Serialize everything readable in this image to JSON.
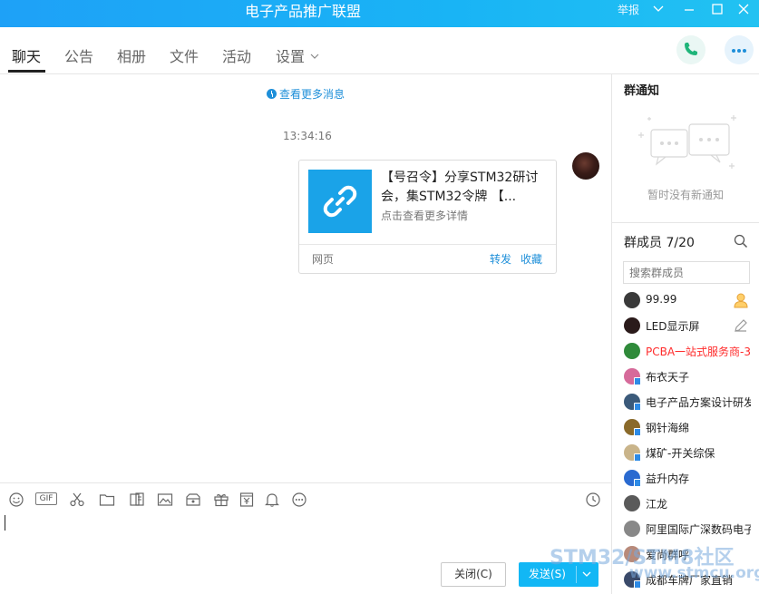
{
  "window": {
    "title": "电子产品推广联盟",
    "report_label": "举报"
  },
  "tabs": [
    {
      "label": "聊天"
    },
    {
      "label": "公告"
    },
    {
      "label": "相册"
    },
    {
      "label": "文件"
    },
    {
      "label": "活动"
    },
    {
      "label": "设置"
    }
  ],
  "chat": {
    "more_messages": "查看更多消息",
    "timestamp": "13:34:16",
    "card": {
      "title": "【号召令】分享STM32研讨会，集STM32令牌 【...",
      "subtitle": "点击查看更多详情",
      "footer_label": "网页",
      "forward_label": "转发",
      "favorite_label": "收藏"
    }
  },
  "input": {
    "close_label": "关闭(C)",
    "send_label": "发送(S)"
  },
  "sidebar": {
    "notice_title": "群通知",
    "notice_empty": "暂时没有新通知",
    "members_title": "群成员 7/20",
    "member_search_placeholder": "搜索群成员",
    "members": [
      {
        "name": "99.99",
        "color": "#3a3a3a",
        "red": false,
        "badge": false
      },
      {
        "name": "LED显示屏",
        "color": "#2a1a1a",
        "red": false,
        "badge": false
      },
      {
        "name": "PCBA一站式服务商-3",
        "color": "#2f8a3a",
        "red": true,
        "badge": false
      },
      {
        "name": "布衣天子",
        "color": "#d66a9a",
        "red": false,
        "badge": true
      },
      {
        "name": "电子产品方案设计研发",
        "color": "#3b5a7a",
        "red": false,
        "badge": true
      },
      {
        "name": "钢针海绵",
        "color": "#8a6a2a",
        "red": false,
        "badge": true
      },
      {
        "name": "煤矿-开关综保",
        "color": "#c9b48a",
        "red": false,
        "badge": true
      },
      {
        "name": "益升内存",
        "color": "#2a6ad0",
        "red": false,
        "badge": true
      },
      {
        "name": "江龙",
        "color": "#5a5a5a",
        "red": false,
        "badge": false
      },
      {
        "name": "阿里国际广深数码电子",
        "color": "#888888",
        "red": false,
        "badge": false
      },
      {
        "name": "爱尚群呼",
        "color": "#b88a7a",
        "red": false,
        "badge": false
      },
      {
        "name": "成都车牌厂家直销",
        "color": "#3a4a6a",
        "red": false,
        "badge": true
      }
    ]
  },
  "watermark": {
    "line1": "STM32/STM8社区",
    "line2": "www.stmcu.org.cn"
  },
  "colors": {
    "accent": "#12b7f5",
    "link": "#1e8fd9"
  }
}
